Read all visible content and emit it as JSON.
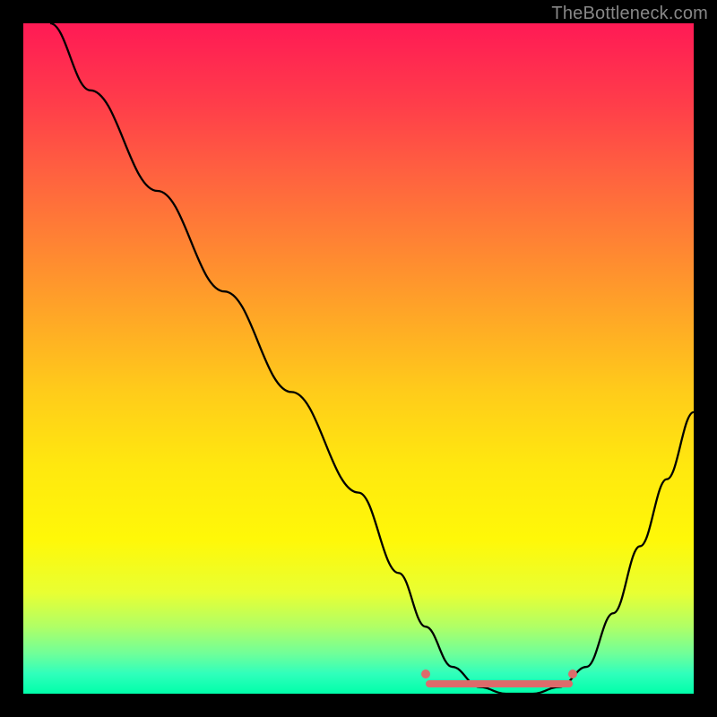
{
  "watermark": "TheBottleneck.com",
  "chart_data": {
    "type": "line",
    "title": "",
    "xlabel": "",
    "ylabel": "",
    "xlim": [
      0,
      100
    ],
    "ylim": [
      0,
      100
    ],
    "series": [
      {
        "name": "curve",
        "x": [
          4,
          10,
          20,
          30,
          40,
          50,
          56,
          60,
          64,
          68,
          72,
          76,
          80,
          84,
          88,
          92,
          96,
          100
        ],
        "y": [
          100,
          90,
          75,
          60,
          45,
          30,
          18,
          10,
          4,
          1,
          0,
          0,
          1,
          4,
          12,
          22,
          32,
          42
        ]
      }
    ],
    "highlight_band": {
      "x_start": 60,
      "x_end": 82,
      "y": 1.5
    },
    "markers": [
      {
        "x": 60,
        "y": 3
      },
      {
        "x": 82,
        "y": 3
      }
    ],
    "gradient_stops": [
      {
        "pct": 0,
        "color": "#ff1a55"
      },
      {
        "pct": 50,
        "color": "#ffcc1a"
      },
      {
        "pct": 100,
        "color": "#00ffaa"
      }
    ]
  }
}
